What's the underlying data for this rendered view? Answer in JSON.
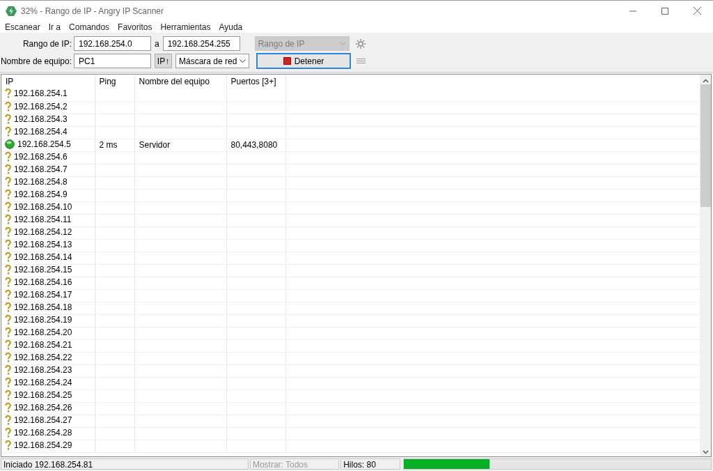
{
  "window": {
    "title": "32% - Rango de IP - Angry IP Scanner"
  },
  "menu": [
    "Escanear",
    "Ir a",
    "Comandos",
    "Favoritos",
    "Herramientas",
    "Ayuda"
  ],
  "toolbar": {
    "range_label": "Rango de IP:",
    "range_from": "192.168.254.0",
    "range_to_label": "a",
    "range_to": "192.168.254.255",
    "feeder": {
      "value": "Rango de IP",
      "disabled": true
    },
    "host_label": "Nombre de equipo:",
    "host": "PC1",
    "ip_button": "IP↑",
    "netmask": "Máscara de red",
    "stop_button": "Detener"
  },
  "table": {
    "columns": [
      "IP",
      "Ping",
      "Nombre del equipo",
      "Puertos [3+]"
    ],
    "rows": [
      {
        "kind": "unknown",
        "cells": [
          "192.168.254.1",
          "",
          "",
          ""
        ]
      },
      {
        "kind": "unknown",
        "cells": [
          "192.168.254.2",
          "",
          "",
          ""
        ]
      },
      {
        "kind": "unknown",
        "cells": [
          "192.168.254.3",
          "",
          "",
          ""
        ]
      },
      {
        "kind": "unknown",
        "cells": [
          "192.168.254.4",
          "",
          "",
          ""
        ]
      },
      {
        "kind": "alive",
        "cells": [
          "192.168.254.5",
          "2 ms",
          "Servidor",
          "80,443,8080"
        ]
      },
      {
        "kind": "unknown",
        "cells": [
          "192.168.254.6",
          "",
          "",
          ""
        ]
      },
      {
        "kind": "unknown",
        "cells": [
          "192.168.254.7",
          "",
          "",
          ""
        ]
      },
      {
        "kind": "unknown",
        "cells": [
          "192.168.254.8",
          "",
          "",
          ""
        ]
      },
      {
        "kind": "unknown",
        "cells": [
          "192.168.254.9",
          "",
          "",
          ""
        ]
      },
      {
        "kind": "unknown",
        "cells": [
          "192.168.254.10",
          "",
          "",
          ""
        ]
      },
      {
        "kind": "unknown",
        "cells": [
          "192.168.254.11",
          "",
          "",
          ""
        ]
      },
      {
        "kind": "unknown",
        "cells": [
          "192.168.254.12",
          "",
          "",
          ""
        ]
      },
      {
        "kind": "unknown",
        "cells": [
          "192.168.254.13",
          "",
          "",
          ""
        ]
      },
      {
        "kind": "unknown",
        "cells": [
          "192.168.254.14",
          "",
          "",
          ""
        ]
      },
      {
        "kind": "unknown",
        "cells": [
          "192.168.254.15",
          "",
          "",
          ""
        ]
      },
      {
        "kind": "unknown",
        "cells": [
          "192.168.254.16",
          "",
          "",
          ""
        ]
      },
      {
        "kind": "unknown",
        "cells": [
          "192.168.254.17",
          "",
          "",
          ""
        ]
      },
      {
        "kind": "unknown",
        "cells": [
          "192.168.254.18",
          "",
          "",
          ""
        ]
      },
      {
        "kind": "unknown",
        "cells": [
          "192.168.254.19",
          "",
          "",
          ""
        ]
      },
      {
        "kind": "unknown",
        "cells": [
          "192.168.254.20",
          "",
          "",
          ""
        ]
      },
      {
        "kind": "unknown",
        "cells": [
          "192.168.254.21",
          "",
          "",
          ""
        ]
      },
      {
        "kind": "unknown",
        "cells": [
          "192.168.254.22",
          "",
          "",
          ""
        ]
      },
      {
        "kind": "unknown",
        "cells": [
          "192.168.254.23",
          "",
          "",
          ""
        ]
      },
      {
        "kind": "unknown",
        "cells": [
          "192.168.254.24",
          "",
          "",
          ""
        ]
      },
      {
        "kind": "unknown",
        "cells": [
          "192.168.254.25",
          "",
          "",
          ""
        ]
      },
      {
        "kind": "unknown",
        "cells": [
          "192.168.254.26",
          "",
          "",
          ""
        ]
      },
      {
        "kind": "unknown",
        "cells": [
          "192.168.254.27",
          "",
          "",
          ""
        ]
      },
      {
        "kind": "unknown",
        "cells": [
          "192.168.254.28",
          "",
          "",
          ""
        ]
      },
      {
        "kind": "unknown",
        "cells": [
          "192.168.254.29",
          "",
          "",
          ""
        ]
      }
    ]
  },
  "status_bar": {
    "status": "Iniciado 192.168.254.81",
    "display": "Mostrar: Todos",
    "threads": "Hilos: 80",
    "progress": {
      "level": 0.28
    }
  }
}
